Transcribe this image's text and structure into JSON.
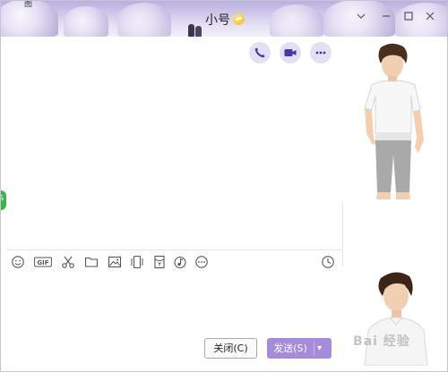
{
  "window": {
    "title": "小号",
    "corner_fragment": "图"
  },
  "titlebar": {
    "menu_icon": "chevron-down-icon",
    "min_icon": "minimize-icon",
    "max_icon": "maximize-icon",
    "close_icon": "close-icon"
  },
  "call_actions": [
    "phone-icon",
    "video-icon",
    "more-icon"
  ],
  "toolbar": {
    "tools": [
      "emoji-icon",
      "gif-icon",
      "scissors-icon",
      "folder-icon",
      "image-icon",
      "shake-icon",
      "red-packet-icon",
      "music-icon",
      "more-icon"
    ],
    "gif_label": "GIF",
    "history_icon": "clock-icon"
  },
  "buttons": {
    "close_label": "关闭(C)",
    "send_label": "发送(S)",
    "send_dropdown": "▾"
  },
  "colors": {
    "accent": "#a58bd9",
    "header": "#cfc7ea",
    "call_button_bg": "#e4e0f3",
    "icon": "#5a3fb0"
  },
  "watermark": "Bai 经验"
}
